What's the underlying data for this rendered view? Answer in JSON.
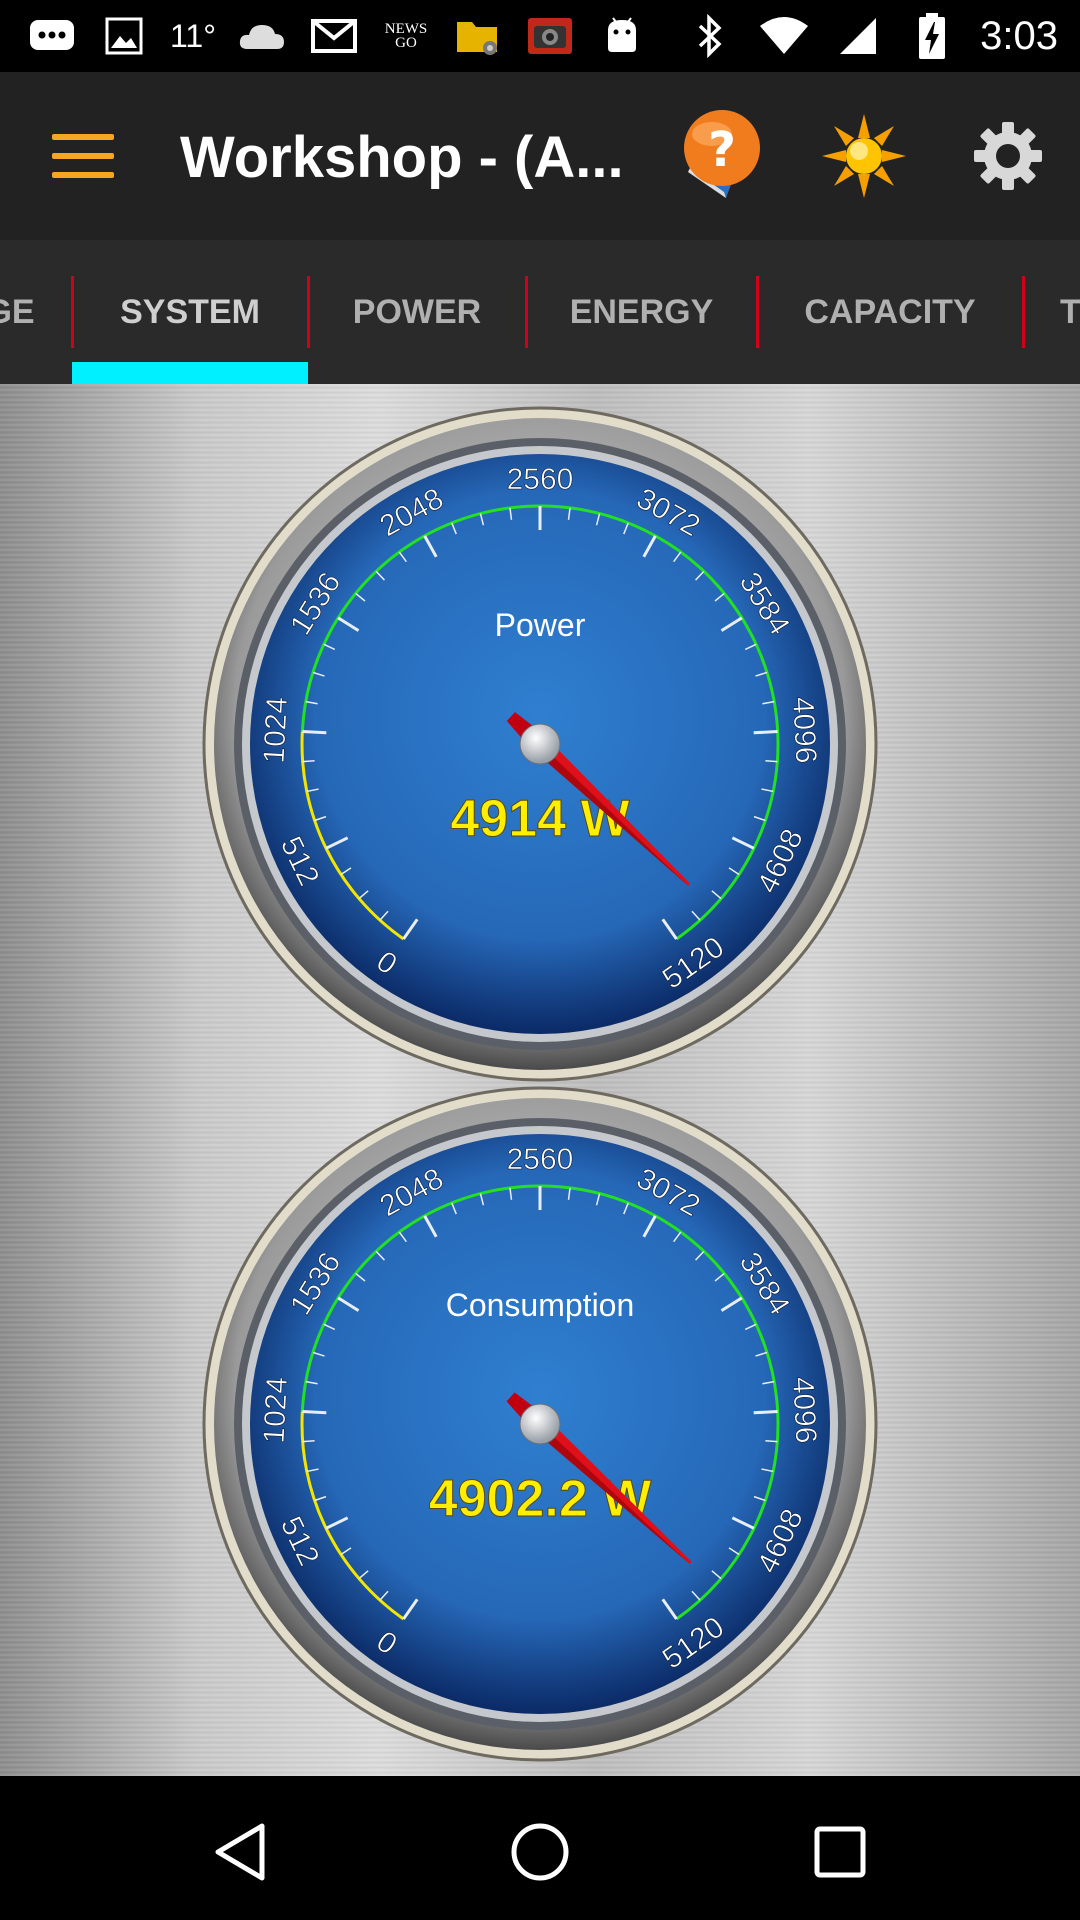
{
  "status_bar": {
    "temperature": "11°",
    "news_label_line1": "NEWS",
    "news_label_line2": "GO",
    "time": "3:03",
    "icons": [
      "messages-icon",
      "gallery-icon",
      "weather-cloud-icon",
      "gmail-icon",
      "ctv-news-icon",
      "file-manager-icon",
      "camera-icon",
      "android-debug-icon",
      "bluetooth-icon",
      "wifi-icon",
      "signal-icon",
      "battery-charging-icon"
    ]
  },
  "toolbar": {
    "title": "Workshop - (A...",
    "help_icon": "help-book-icon",
    "brightness_icon": "sun-icon",
    "settings_icon": "gear-icon",
    "menu_icon": "hamburger-icon",
    "accent_color": "#f5a623"
  },
  "tabs": {
    "items": [
      {
        "label": "GE"
      },
      {
        "label": "SYSTEM",
        "active": true
      },
      {
        "label": "POWER"
      },
      {
        "label": "ENERGY"
      },
      {
        "label": "CAPACITY"
      },
      {
        "label": "T"
      }
    ],
    "indicator_color": "#00f0ff",
    "separator_color": "#d0021b"
  },
  "gauges": [
    {
      "name": "power",
      "label": "Power",
      "value": 4914,
      "readout": "4914 W",
      "unit": "W",
      "scale_min": 0,
      "scale_max": 5120,
      "tick_labels": [
        "0",
        "512",
        "1024",
        "1536",
        "2048",
        "2560",
        "3072",
        "3584",
        "4096",
        "4608",
        "5120"
      ]
    },
    {
      "name": "consumption",
      "label": "Consumption",
      "value": 4902.2,
      "readout": "4902.2 W",
      "unit": "W",
      "scale_min": 0,
      "scale_max": 5120,
      "tick_labels": [
        "0",
        "512",
        "1024",
        "1536",
        "2048",
        "2560",
        "3072",
        "3584",
        "4096",
        "4608",
        "5120"
      ]
    }
  ],
  "gauge_style": {
    "face_color": "#2f7fd0",
    "arc_low_color": "#f2e600",
    "arc_high_color": "#22e022",
    "needle_color": "#e0101a",
    "readout_color": "#ffee00"
  },
  "nav_bar": {
    "icons": [
      "back-icon",
      "home-icon",
      "recents-icon"
    ]
  }
}
